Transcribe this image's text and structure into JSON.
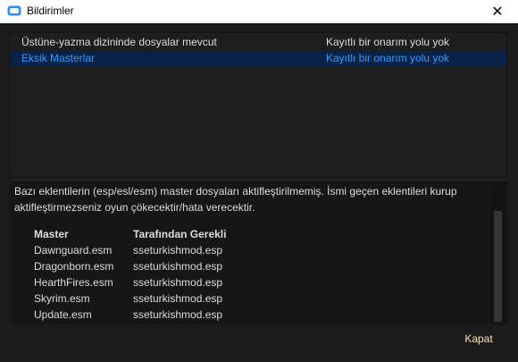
{
  "window": {
    "title": "Bildirimler",
    "close_glyph": "✕"
  },
  "issues": [
    {
      "description": "Üstüne-yazma dizininde dosyalar mevcut",
      "fix": "Kayıtlı bir onarım yolu yok",
      "selected": false
    },
    {
      "description": "Eksik Masterlar",
      "fix": "Kayıtlı bir onarım yolu yok",
      "selected": true
    }
  ],
  "detail": {
    "text": "Bazı eklentilerin (esp/esl/esm) master dosyaları aktifleştirilmemiş. İsmi geçen eklentileri kurup aktifleştirmezseniz oyun çökecektir/hata verecektir.",
    "columns": [
      "Master",
      "Tarafından Gerekli"
    ],
    "rows": [
      [
        "Dawnguard.esm",
        "sseturkishmod.esp"
      ],
      [
        "Dragonborn.esm",
        "sseturkishmod.esp"
      ],
      [
        "HearthFires.esm",
        "sseturkishmod.esp"
      ],
      [
        "Skyrim.esm",
        "sseturkishmod.esp"
      ],
      [
        "Update.esm",
        "sseturkishmod.esp"
      ]
    ]
  },
  "footer": {
    "close_label": "Kapat"
  },
  "colors": {
    "selection_bg": "#0a2247",
    "selection_text": "#2e9bff",
    "app_icon": "#2f8cff",
    "close_label": "#ffe0b0"
  }
}
